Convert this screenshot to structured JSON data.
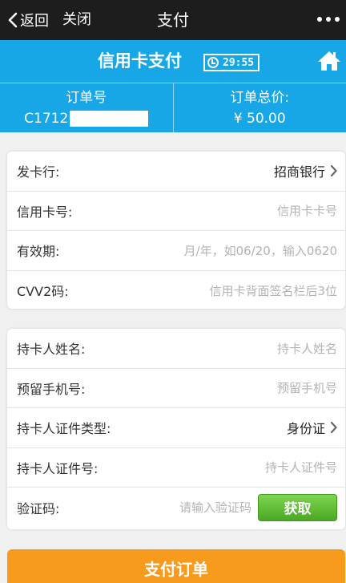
{
  "nav": {
    "back_label": "返回",
    "close_label": "关闭",
    "title": "支付"
  },
  "header": {
    "title": "信用卡支付",
    "timer": "29:55"
  },
  "order": {
    "number_label": "订单号",
    "number_prefix": "C1712",
    "total_label": "订单总价:",
    "total_value": "¥ 50.00"
  },
  "card_section": {
    "issuer_label": "发卡行:",
    "issuer_value": "招商银行",
    "card_number_label": "信用卡号:",
    "card_number_placeholder": "信用卡卡号",
    "expiry_label": "有效期:",
    "expiry_placeholder": "月/年，如06/20，输入0620",
    "cvv_label": "CVV2码:",
    "cvv_placeholder": "信用卡背面签名栏后3位"
  },
  "holder_section": {
    "name_label": "持卡人姓名:",
    "name_placeholder": "持卡人姓名",
    "phone_label": "预留手机号:",
    "phone_placeholder": "预留手机号",
    "id_type_label": "持卡人证件类型:",
    "id_type_value": "身份证",
    "id_number_label": "持卡人证件号:",
    "id_number_placeholder": "持卡人证件号",
    "code_label": "验证码:",
    "code_placeholder": "请输入验证码",
    "get_code_label": "获取"
  },
  "pay_button_label": "支付订单",
  "colors": {
    "header_blue": "#18a7e6",
    "pay_orange": "#f89b1d",
    "get_green": "#5cbf2a",
    "nav_dark": "#1d1d1d"
  }
}
